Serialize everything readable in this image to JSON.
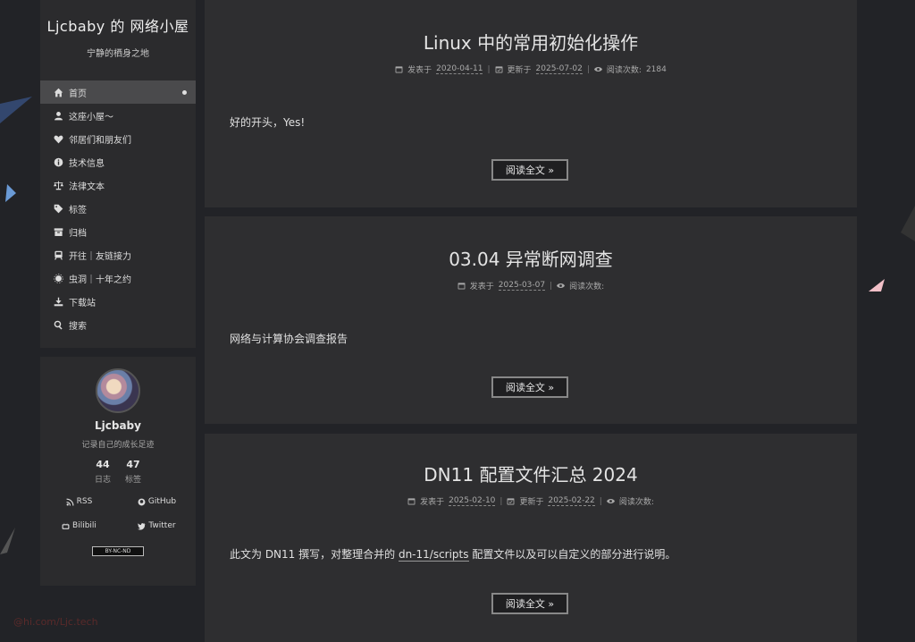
{
  "site": {
    "title": "Ljcbaby 的 网络小屋",
    "subtitle": "宁静的栖身之地"
  },
  "menu": [
    {
      "label": "首页",
      "icon": "home-icon",
      "active": true
    },
    {
      "label": "这座小屋～",
      "icon": "user-icon"
    },
    {
      "label": "邻居们和朋友们",
      "icon": "heartbeat-icon"
    },
    {
      "label": "技术信息",
      "icon": "info-icon"
    },
    {
      "label": "法律文本",
      "icon": "balance-scale-icon"
    },
    {
      "label": "标签",
      "icon": "tags-icon"
    },
    {
      "label": "归档",
      "icon": "archive-icon"
    },
    {
      "label": "开往｜友链接力",
      "icon": "subway-icon"
    },
    {
      "label": "虫洞｜十年之约",
      "icon": "wormhole-icon"
    },
    {
      "label": "下载站",
      "icon": "download-icon"
    },
    {
      "label": "搜索",
      "icon": "search-icon"
    }
  ],
  "author": {
    "name": "Ljcbaby",
    "description": "记录自己的成长足迹",
    "stats": [
      {
        "count": "44",
        "label": "日志"
      },
      {
        "count": "47",
        "label": "标签"
      }
    ],
    "links": [
      {
        "label": "RSS",
        "icon": "rss-icon"
      },
      {
        "label": "GitHub",
        "icon": "github-icon"
      },
      {
        "label": "Bilibili",
        "icon": "bilibili-icon"
      },
      {
        "label": "Twitter",
        "icon": "twitter-icon"
      }
    ],
    "license": "BY-NC-ND"
  },
  "watermark": "@hi.com/Ljc.tech",
  "posts": [
    {
      "title": "Linux 中的常用初始化操作",
      "posted_label": "发表于",
      "posted": "2020-04-11",
      "updated_label": "更新于",
      "updated": "2025-07-02",
      "views_label": "阅读次数:",
      "views": "2184",
      "excerpt": "好的开头，Yes!",
      "read_more": "阅读全文 »"
    },
    {
      "title": "03.04 异常断网调查",
      "posted_label": "发表于",
      "posted": "2025-03-07",
      "views_label": "阅读次数:",
      "excerpt": "网络与计算协会调查报告",
      "read_more": "阅读全文 »"
    },
    {
      "title": "DN11 配置文件汇总 2024",
      "posted_label": "发表于",
      "posted": "2025-02-10",
      "updated_label": "更新于",
      "updated": "2025-02-22",
      "views_label": "阅读次数:",
      "excerpt_before": "此文为 DN11 撰写，对整理合并的",
      "excerpt_link": "dn-11/scripts",
      "excerpt_after": "配置文件以及可以自定义的部分进行说明。",
      "read_more": "阅读全文 »"
    }
  ]
}
